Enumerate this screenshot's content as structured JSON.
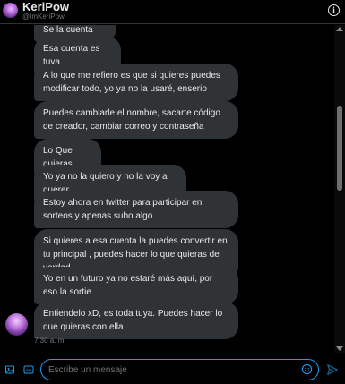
{
  "header": {
    "name": "KeriPow",
    "handle": "@ImKeriPow",
    "info_glyph": "i"
  },
  "messages": [
    {
      "text": "Se la cuenta"
    },
    {
      "text": "Esa cuenta es tuya"
    },
    {
      "text": "A lo que me refiero es que si quieres puedes modificar todo, yo ya no la usaré, enserio"
    },
    {
      "text": "Puedes cambiarle el nombre, sacarte código de creador, cambiar correo y contraseña"
    },
    {
      "text": "Lo Que quieras"
    },
    {
      "text": "Yo ya no la quiero y no la voy a querer"
    },
    {
      "text": "Estoy ahora en twitter para participar en sorteos y apenas subo algo"
    },
    {
      "text": "Si quieres a esa cuenta la puedes convertir en tu principal , puedes hacer lo que quieras de verdad"
    },
    {
      "text": "Yo en un futuro ya no estaré más aquí,  por eso la sortie"
    },
    {
      "text": "Entiendelo xD, es toda tuya. Puedes hacer lo que quieras con ella"
    }
  ],
  "timestamp": "7:30 a. m.",
  "composer": {
    "placeholder": "Escribe un mensaje",
    "gif_label": "GIF"
  },
  "colors": {
    "accent": "#1d9bf0",
    "bubble": "#2f3336",
    "background": "#000000",
    "muted": "#71767b"
  },
  "icons": [
    "info-icon",
    "image-icon",
    "gif-icon",
    "emoji-icon",
    "send-icon"
  ]
}
